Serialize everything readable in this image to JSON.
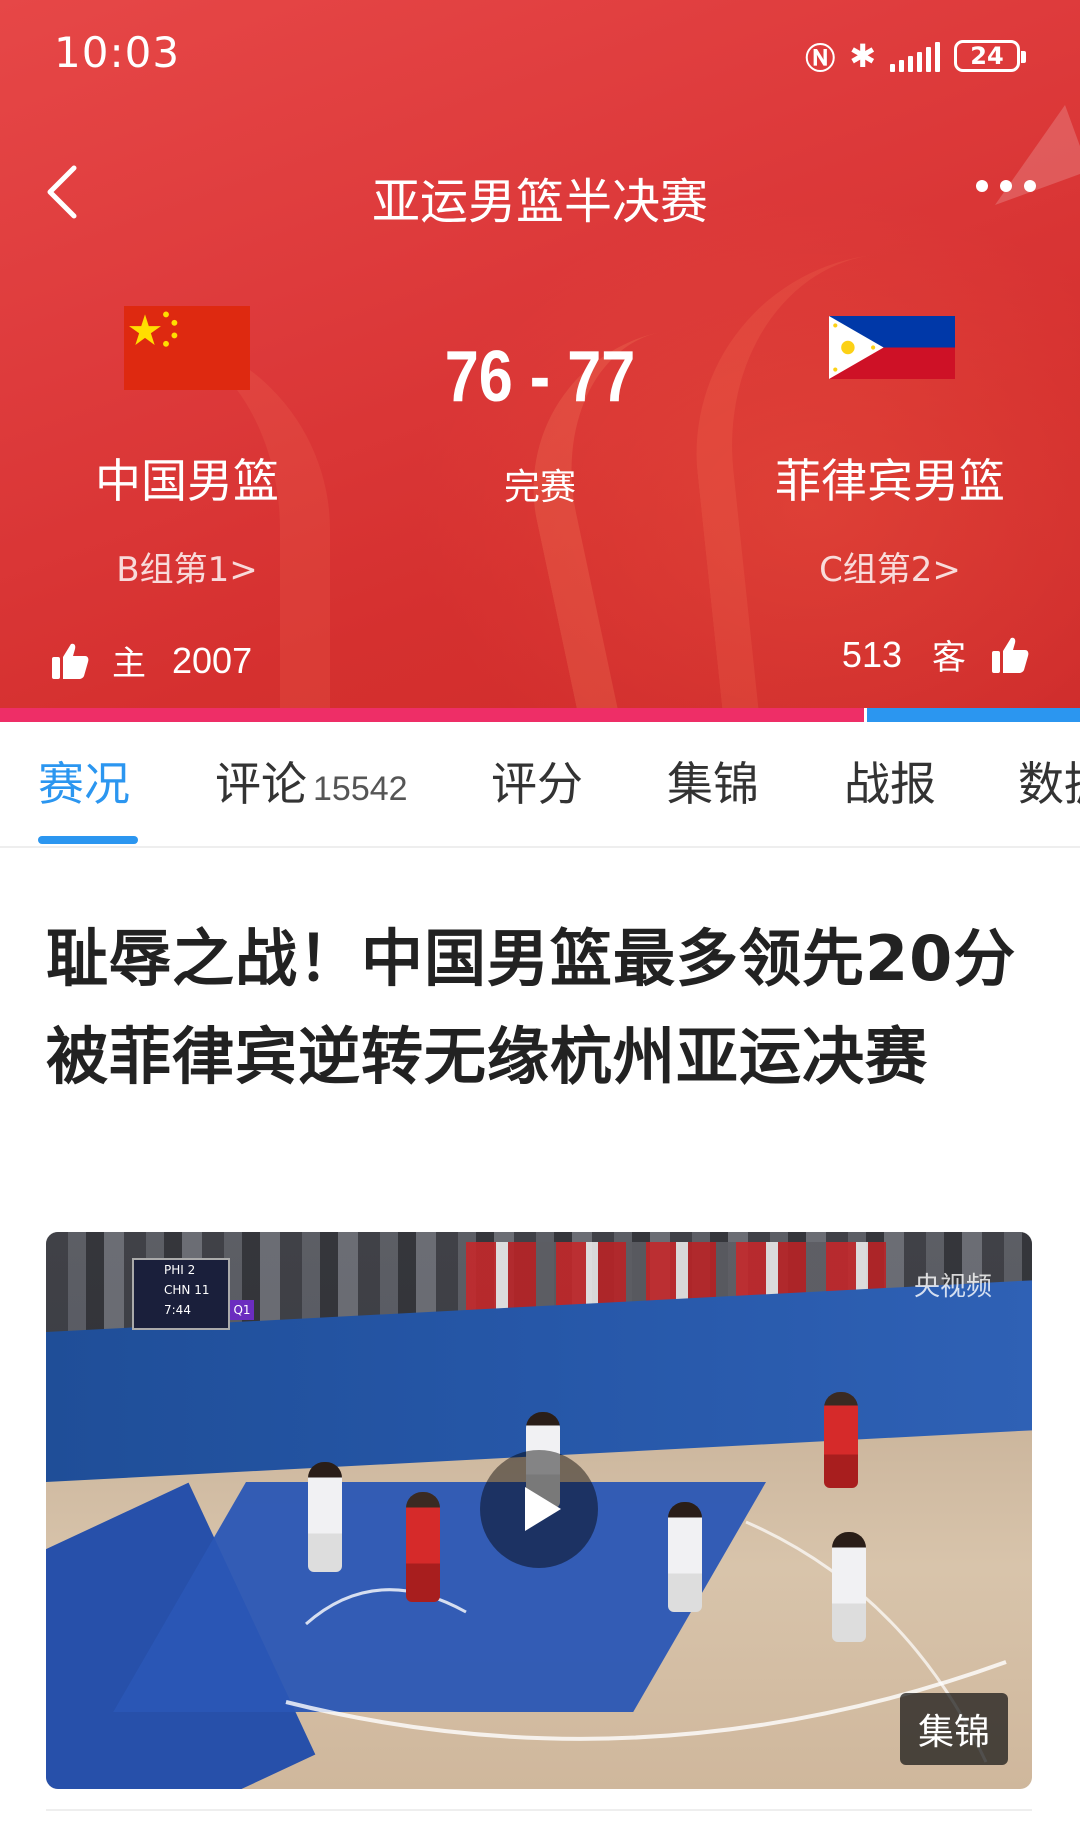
{
  "status_bar": {
    "time": "10:03",
    "battery": "24"
  },
  "header": {
    "title": "亚运男篮半决赛",
    "score": "76 - 77",
    "match_status": "完赛",
    "home": {
      "name": "中国男篮",
      "rank": "B组第1>",
      "side_label": "主",
      "likes": "2007"
    },
    "away": {
      "name": "菲律宾男篮",
      "rank": "C组第2>",
      "side_label": "客",
      "likes": "513"
    },
    "vote_share_home": 0.8
  },
  "tabs": [
    {
      "label": "赛况"
    },
    {
      "label": "评论",
      "count": "15542"
    },
    {
      "label": "评分"
    },
    {
      "label": "集锦"
    },
    {
      "label": "战报"
    },
    {
      "label": "数据"
    }
  ],
  "article": {
    "title": "耻辱之战！中国男篮最多领先20分 被菲律宾逆转无缘杭州亚运决赛",
    "video_badge": "集锦"
  },
  "video": {
    "scorebug": {
      "team1": "PHI",
      "score1": "2",
      "team2": "CHN",
      "score2": "11",
      "clock": "7:44",
      "period": "Q1"
    },
    "watermark": "央视频"
  },
  "colors": {
    "header_red": "#de3b3c",
    "accent_blue": "#2b96f0",
    "home_vote_pink": "#ee2e67"
  }
}
